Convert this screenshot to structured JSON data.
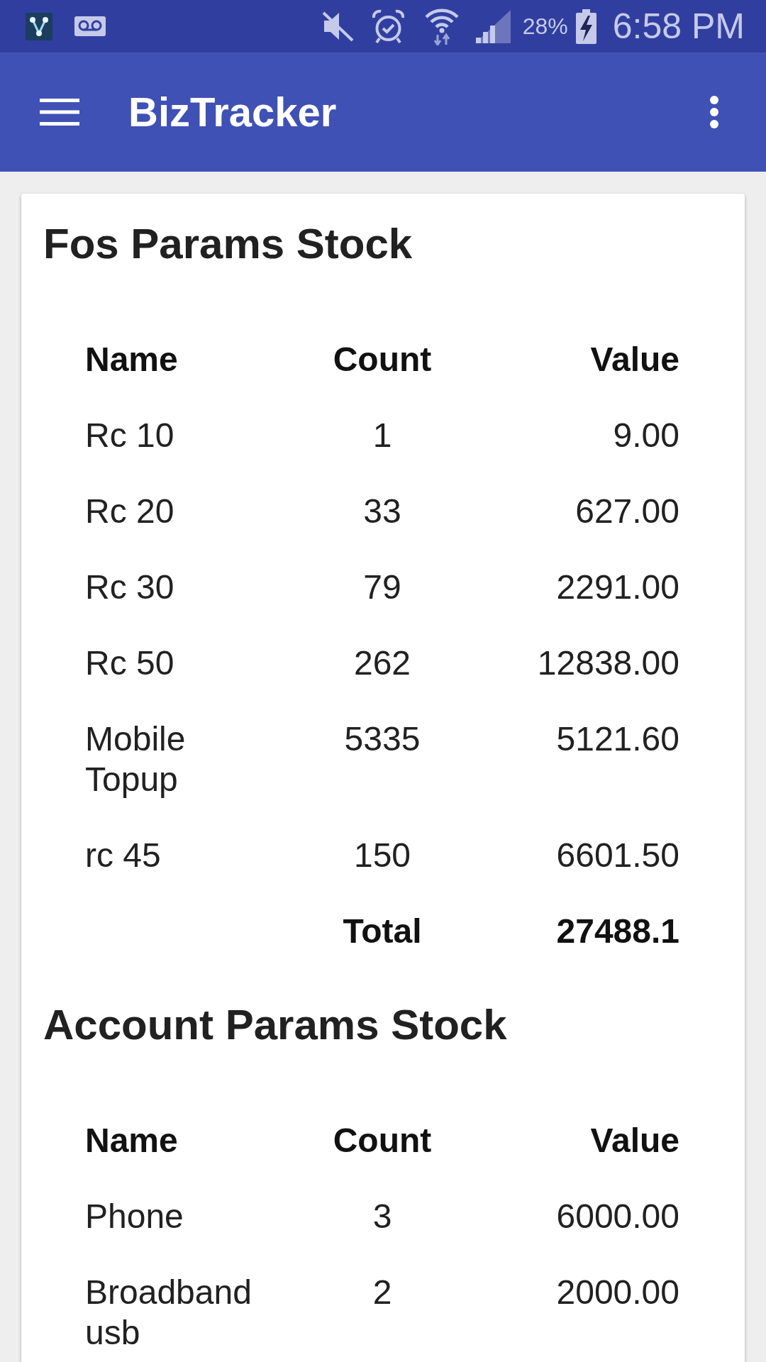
{
  "status_bar": {
    "battery_text": "28%",
    "time": "6:58 PM"
  },
  "app_bar": {
    "title": "BizTracker"
  },
  "sections": [
    {
      "title": "Fos Params Stock",
      "columns": [
        "Name",
        "Count",
        "Value"
      ],
      "rows": [
        {
          "name": "Rc 10",
          "count": "1",
          "value": "9.00"
        },
        {
          "name": "Rc 20",
          "count": "33",
          "value": "627.00"
        },
        {
          "name": "Rc 30",
          "count": "79",
          "value": "2291.00"
        },
        {
          "name": "Rc 50",
          "count": "262",
          "value": "12838.00"
        },
        {
          "name": "Mobile Topup",
          "count": "5335",
          "value": "5121.60"
        },
        {
          "name": "rc 45",
          "count": "150",
          "value": "6601.50"
        }
      ],
      "total": {
        "label": "Total",
        "value": "27488.1"
      }
    },
    {
      "title": "Account Params Stock",
      "columns": [
        "Name",
        "Count",
        "Value"
      ],
      "rows": [
        {
          "name": "Phone",
          "count": "3",
          "value": "6000.00"
        },
        {
          "name": "Broadband usb",
          "count": "2",
          "value": "2000.00"
        }
      ]
    }
  ]
}
